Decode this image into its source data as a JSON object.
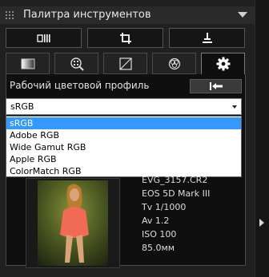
{
  "panel": {
    "title": "Палитра инструментов"
  },
  "toolbar": {
    "buttons": [
      {
        "icon": "film-strip-icon"
      },
      {
        "icon": "crop-icon"
      },
      {
        "icon": "stamp-icon"
      }
    ]
  },
  "tabs": [
    {
      "icon": "picture-adjust-icon"
    },
    {
      "icon": "noise-grid-icon"
    },
    {
      "icon": "tone-curve-icon"
    },
    {
      "icon": "color-circles-icon"
    },
    {
      "icon": "gear-icon",
      "active": true
    }
  ],
  "settings": {
    "profile_label": "Рабочий цветовой профиль",
    "reset_icon": "reset-arrow-icon",
    "selected_value": "sRGB",
    "options": [
      "sRGB",
      "Adobe RGB",
      "Wide Gamut RGB",
      "Apple RGB",
      "ColorMatch RGB"
    ]
  },
  "image_info": {
    "filename": "EVG_3157.CR2",
    "camera": "EOS 5D Mark III",
    "shutter": "Tv 1/1000",
    "aperture": "Av 1.2",
    "iso": "ISO 100",
    "focal": "85.0мм"
  },
  "colors": {
    "accent": "#3399ff",
    "panel_bg": "#202020",
    "content_bg": "#0f0f0f"
  }
}
